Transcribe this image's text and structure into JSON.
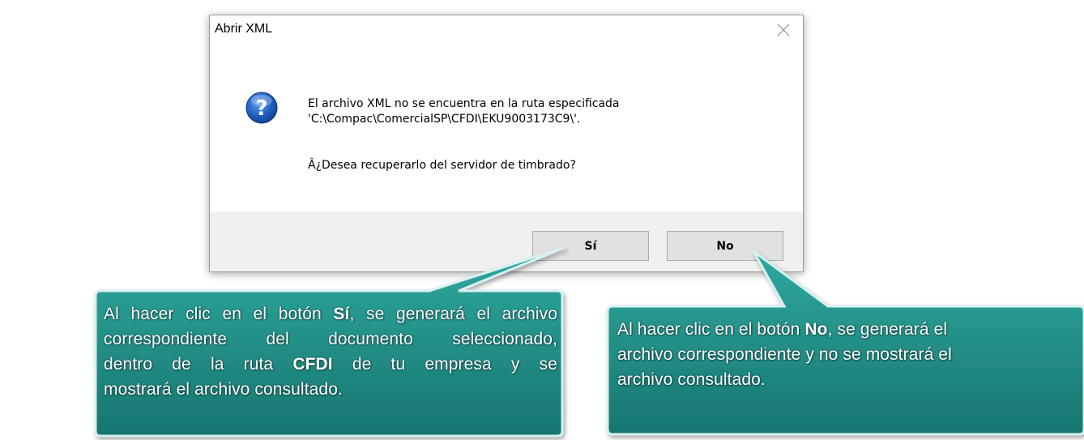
{
  "dialog": {
    "title": "Abrir XML",
    "close_icon": "close-icon",
    "icon": "question-icon",
    "message_line1": "El archivo XML no se encuentra en la ruta especificada",
    "message_line2": "'C:\\Compac\\ComercialSP\\CFDI\\EKU9003173C9\\'.",
    "question": "Â¿Desea recuperarlo del servidor de timbrado?",
    "buttons": {
      "yes": "Sí",
      "no": "No"
    }
  },
  "callouts": {
    "left": {
      "line1_pre": "Al hacer clic en el botón ",
      "line1_bold": "Sí",
      "line1_post": ", se generará el archivo",
      "line2": "correspondiente del documento seleccionado,",
      "line3_pre": "dentro de la ruta ",
      "line3_bold": "CFDI",
      "line3_post": " de tu empresa y se",
      "line4": "mostrará el archivo consultado."
    },
    "right": {
      "line1_pre": "Al hacer clic en el botón ",
      "line1_bold": "No",
      "line1_post": ", se generará el",
      "line2": "archivo correspondiente y no se mostrará el",
      "line3": "archivo consultado."
    }
  },
  "colors": {
    "callout_fill_top": "#2aa29a",
    "callout_fill_bottom": "#1a7f78",
    "callout_border": "#c9ecea",
    "accent_button_border": "#0078d7",
    "question_icon_blue": "#1f5fbf"
  }
}
